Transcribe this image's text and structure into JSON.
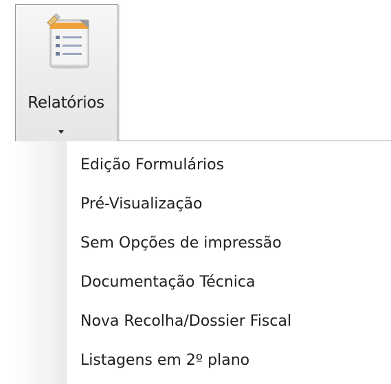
{
  "ribbon": {
    "button_label": "Relatórios",
    "icon": "report-document-icon",
    "dropdown_icon": "chevron-down-icon"
  },
  "menu": {
    "items": [
      {
        "label": "Edição Formulários"
      },
      {
        "label": "Pré-Visualização"
      },
      {
        "label": "Sem Opções de impressão"
      },
      {
        "label": "Documentação Técnica"
      },
      {
        "label": "Nova Recolha/Dossier Fiscal"
      },
      {
        "label": "Listagens em 2º plano"
      }
    ]
  },
  "colors": {
    "icon_accent": "#f0a23a",
    "icon_body": "#e9e9e9",
    "text": "#1f1f1f"
  }
}
